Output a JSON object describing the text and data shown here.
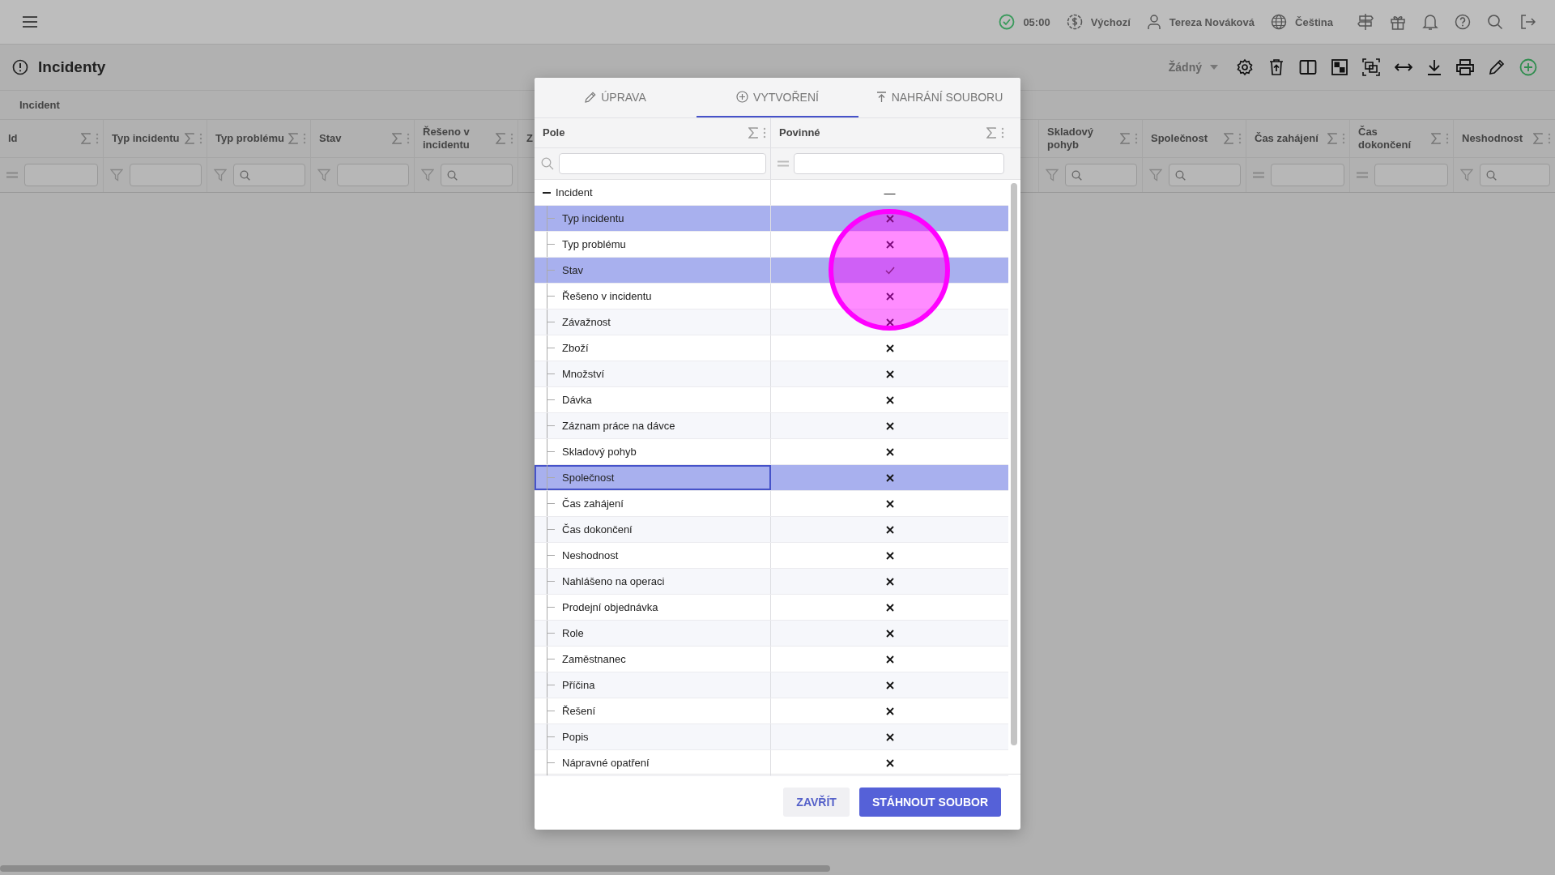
{
  "top_bar": {
    "time": "05:00",
    "currency": "Výchozí",
    "user": "Tereza Nováková",
    "language": "Čeština"
  },
  "page": {
    "title": "Incidenty",
    "view_select": "Žádný"
  },
  "table": {
    "group_header": "Incident",
    "columns_left": [
      {
        "label": "Id",
        "kind": "equals"
      },
      {
        "label": "Typ incidentu",
        "kind": "funnel"
      },
      {
        "label": "Typ problému",
        "kind": "search"
      },
      {
        "label": "Stav",
        "kind": "funnel"
      },
      {
        "label": "Řešeno v incidentu",
        "kind": "search"
      },
      {
        "label": "Z",
        "kind": "cut"
      }
    ],
    "columns_right": [
      {
        "label": "Skladový pohyb",
        "kind": "search"
      },
      {
        "label": "Společnost",
        "kind": "search"
      },
      {
        "label": "Čas zahájení",
        "kind": "equals"
      },
      {
        "label": "Čas dokončení",
        "kind": "equals"
      },
      {
        "label": "Neshodnost",
        "kind": "search"
      }
    ]
  },
  "dialog": {
    "tabs": [
      {
        "label": "ÚPRAVA",
        "selected": false
      },
      {
        "label": "VYTVOŘENÍ",
        "selected": true
      },
      {
        "label": "NAHRÁNÍ SOUBORU",
        "selected": false
      }
    ],
    "columns": [
      "Pole",
      "Povinné"
    ],
    "tree": {
      "label": "Incident",
      "expanded": true,
      "required_text": "—",
      "children": [
        {
          "label": "Typ incidentu",
          "selected": true,
          "focused": false,
          "required": false
        },
        {
          "label": "Typ problému",
          "selected": false,
          "focused": false,
          "required": false
        },
        {
          "label": "Stav",
          "selected": true,
          "focused": false,
          "required": true
        },
        {
          "label": "Řešeno v incidentu",
          "selected": false,
          "focused": false,
          "required": false
        },
        {
          "label": "Závažnost",
          "selected": false,
          "focused": false,
          "required": false
        },
        {
          "label": "Zboží",
          "selected": false,
          "focused": false,
          "required": false
        },
        {
          "label": "Množství",
          "selected": false,
          "focused": false,
          "required": false
        },
        {
          "label": "Dávka",
          "selected": false,
          "focused": false,
          "required": false
        },
        {
          "label": "Záznam práce na dávce",
          "selected": false,
          "focused": false,
          "required": false
        },
        {
          "label": "Skladový pohyb",
          "selected": false,
          "focused": false,
          "required": false
        },
        {
          "label": "Společnost",
          "selected": true,
          "focused": true,
          "required": false
        },
        {
          "label": "Čas zahájení",
          "selected": false,
          "focused": false,
          "required": false
        },
        {
          "label": "Čas dokončení",
          "selected": false,
          "focused": false,
          "required": false
        },
        {
          "label": "Neshodnost",
          "selected": false,
          "focused": false,
          "required": false
        },
        {
          "label": "Nahlášeno na operaci",
          "selected": false,
          "focused": false,
          "required": false
        },
        {
          "label": "Prodejní objednávka",
          "selected": false,
          "focused": false,
          "required": false
        },
        {
          "label": "Role",
          "selected": false,
          "focused": false,
          "required": false
        },
        {
          "label": "Zaměstnanec",
          "selected": false,
          "focused": false,
          "required": false
        },
        {
          "label": "Příčina",
          "selected": false,
          "focused": false,
          "required": false
        },
        {
          "label": "Řešení",
          "selected": false,
          "focused": false,
          "required": false
        },
        {
          "label": "Popis",
          "selected": false,
          "focused": false,
          "required": false
        },
        {
          "label": "Nápravné opatření",
          "selected": false,
          "focused": false,
          "required": false
        }
      ]
    },
    "buttons": {
      "close": "ZAVŘÍT",
      "download": "STÁHNOUT SOUBOR"
    }
  }
}
